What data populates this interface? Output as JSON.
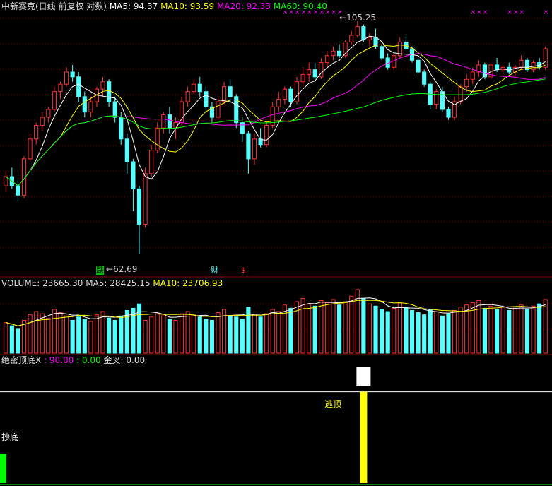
{
  "header": {
    "title": "中新赛克(日线 前复权 对数)",
    "ma5": "MA5: 94.37",
    "ma10": "MA10: 93.59",
    "ma20": "MA20: 92.33",
    "ma60": "MA60: 90.40"
  },
  "volume_header": {
    "volume": "VOLUME: 23665.30",
    "ma5": "MA5: 28425.15",
    "ma10": "MA10: 23706.93"
  },
  "indicator_header": {
    "name": "绝密顶底X",
    "line1": ": 90.00",
    "line2": ": 0.00",
    "gold": "金叉: 0.00"
  },
  "annotations": {
    "high": "105.25",
    "low": "62.69",
    "tag_die": "跌",
    "tag_cai": "财",
    "tag_s": "$",
    "chaodi": "抄底",
    "taoding": "逃顶"
  },
  "colors": {
    "up": "#FF3232",
    "down": "#54FFFF",
    "ma5": "#FFFFFF",
    "ma10": "#FFFF00",
    "ma20": "#FF00FF",
    "ma60": "#00FF00",
    "grid": "#8B0000"
  },
  "chart_data": {
    "type": "candlestick",
    "price_high": 105.25,
    "price_low": 62.69,
    "candles": [
      [
        73.0,
        75.5,
        72.0,
        74.5
      ],
      [
        74.5,
        76.0,
        72.5,
        73.0
      ],
      [
        73.0,
        74.0,
        70.5,
        71.5
      ],
      [
        71.5,
        78.0,
        71.0,
        77.5
      ],
      [
        77.5,
        82.0,
        77.0,
        81.0
      ],
      [
        81.0,
        84.0,
        80.0,
        83.5
      ],
      [
        83.5,
        86.0,
        82.5,
        85.0
      ],
      [
        85.0,
        87.0,
        84.0,
        86.5
      ],
      [
        86.5,
        91.0,
        86.0,
        90.0
      ],
      [
        90.0,
        92.0,
        88.5,
        91.5
      ],
      [
        91.5,
        95.0,
        91.0,
        94.0
      ],
      [
        94.0,
        95.5,
        92.0,
        93.0
      ],
      [
        93.0,
        94.0,
        88.0,
        89.0
      ],
      [
        89.0,
        90.0,
        85.0,
        86.0
      ],
      [
        86.0,
        89.0,
        85.0,
        88.0
      ],
      [
        88.0,
        91.0,
        87.0,
        90.5
      ],
      [
        90.5,
        93.0,
        89.0,
        92.0
      ],
      [
        92.0,
        92.5,
        87.0,
        88.0
      ],
      [
        88.0,
        89.0,
        84.0,
        85.0
      ],
      [
        85.0,
        86.0,
        80.0,
        81.0
      ],
      [
        81.0,
        82.0,
        75.0,
        77.0
      ],
      [
        77.0,
        77.5,
        69.0,
        72.5
      ],
      [
        72.5,
        73.0,
        62.69,
        67.0
      ],
      [
        67.0,
        76.0,
        66.5,
        75.0
      ],
      [
        75.0,
        80.0,
        74.5,
        79.0
      ],
      [
        79.0,
        84.0,
        78.5,
        83.0
      ],
      [
        83.0,
        86.0,
        82.0,
        85.5
      ],
      [
        85.5,
        87.0,
        82.0,
        83.0
      ],
      [
        83.0,
        85.0,
        81.0,
        84.0
      ],
      [
        84.0,
        89.0,
        83.5,
        88.0
      ],
      [
        88.0,
        91.0,
        87.0,
        90.0
      ],
      [
        90.0,
        92.5,
        89.5,
        91.5
      ],
      [
        91.5,
        93.0,
        89.0,
        90.0
      ],
      [
        90.0,
        91.0,
        86.0,
        87.0
      ],
      [
        87.0,
        88.0,
        84.0,
        85.0
      ],
      [
        85.0,
        89.0,
        84.5,
        88.0
      ],
      [
        88.0,
        92.0,
        87.5,
        91.0
      ],
      [
        91.0,
        92.5,
        88.0,
        89.0
      ],
      [
        89.0,
        89.5,
        83.0,
        84.0
      ],
      [
        84.0,
        85.0,
        80.5,
        82.0
      ],
      [
        82.0,
        82.5,
        75.0,
        77.5
      ],
      [
        77.5,
        82.0,
        76.5,
        81.0
      ],
      [
        81.0,
        83.0,
        79.5,
        80.0
      ],
      [
        80.0,
        84.0,
        79.5,
        83.5
      ],
      [
        83.5,
        88.0,
        83.0,
        87.0
      ],
      [
        87.0,
        90.0,
        86.0,
        88.5
      ],
      [
        88.5,
        91.0,
        87.5,
        90.5
      ],
      [
        90.5,
        91.0,
        87.0,
        88.0
      ],
      [
        88.0,
        93.0,
        87.5,
        92.0
      ],
      [
        92.0,
        95.0,
        91.0,
        93.5
      ],
      [
        93.5,
        96.0,
        92.0,
        94.5
      ],
      [
        94.5,
        96.0,
        92.5,
        93.0
      ],
      [
        93.0,
        97.0,
        92.5,
        96.0
      ],
      [
        96.0,
        98.5,
        95.0,
        97.5
      ],
      [
        97.5,
        99.5,
        96.5,
        98.5
      ],
      [
        98.5,
        100.0,
        97.0,
        97.5
      ],
      [
        97.5,
        101.0,
        97.0,
        100.5
      ],
      [
        100.5,
        103.0,
        100.0,
        102.0
      ],
      [
        102.0,
        105.25,
        101.5,
        104.0
      ],
      [
        104.0,
        104.5,
        100.5,
        101.0
      ],
      [
        101.0,
        102.5,
        99.5,
        101.5
      ],
      [
        101.5,
        103.5,
        99.0,
        99.5
      ],
      [
        99.5,
        100.0,
        96.5,
        97.0
      ],
      [
        97.0,
        98.0,
        94.5,
        95.0
      ],
      [
        95.0,
        98.0,
        94.5,
        97.5
      ],
      [
        97.5,
        101.5,
        97.0,
        100.5
      ],
      [
        100.5,
        102.0,
        98.5,
        99.0
      ],
      [
        99.0,
        99.5,
        96.0,
        96.5
      ],
      [
        96.5,
        97.0,
        93.5,
        94.0
      ],
      [
        94.0,
        94.5,
        91.0,
        91.5
      ],
      [
        91.5,
        92.0,
        86.5,
        87.5
      ],
      [
        87.5,
        90.5,
        86.5,
        90.0
      ],
      [
        90.0,
        91.0,
        86.0,
        86.5
      ],
      [
        86.5,
        87.0,
        84.5,
        85.0
      ],
      [
        85.0,
        89.0,
        84.5,
        88.0
      ],
      [
        88.0,
        91.5,
        87.5,
        91.0
      ],
      [
        91.0,
        93.5,
        90.0,
        92.5
      ],
      [
        92.5,
        95.0,
        91.5,
        94.0
      ],
      [
        94.0,
        96.5,
        93.0,
        95.5
      ],
      [
        95.5,
        96.0,
        92.5,
        93.0
      ],
      [
        93.0,
        96.0,
        92.5,
        95.5
      ],
      [
        95.5,
        97.0,
        94.0,
        94.5
      ],
      [
        94.5,
        95.5,
        93.0,
        95.0
      ],
      [
        95.0,
        96.0,
        93.5,
        94.0
      ],
      [
        94.0,
        95.5,
        93.0,
        95.0
      ],
      [
        95.0,
        97.5,
        94.5,
        96.5
      ],
      [
        96.5,
        97.0,
        94.0,
        94.5
      ],
      [
        94.5,
        96.5,
        94.0,
        96.0
      ],
      [
        96.0,
        97.0,
        94.5,
        95.0
      ],
      [
        95.0,
        99.5,
        94.5,
        99.0
      ]
    ],
    "volume": [
      28,
      25,
      22,
      30,
      35,
      38,
      36,
      32,
      40,
      37,
      34,
      30,
      33,
      31,
      29,
      35,
      38,
      32,
      30,
      34,
      39,
      41,
      45,
      30,
      33,
      36,
      34,
      31,
      30,
      36,
      38,
      35,
      33,
      31,
      30,
      37,
      40,
      34,
      33,
      31,
      42,
      35,
      33,
      36,
      40,
      38,
      44,
      41,
      47,
      50,
      45,
      43,
      48,
      46,
      49,
      44,
      47,
      52,
      58,
      50,
      45,
      43,
      40,
      38,
      41,
      46,
      42,
      39,
      37,
      35,
      40,
      38,
      34,
      36,
      39,
      42,
      44,
      46,
      48,
      41,
      43,
      40,
      42,
      39,
      41,
      44,
      40,
      43,
      45,
      49
    ],
    "signals": [
      {
        "index": 59,
        "label": "逃顶",
        "value": 90.0
      },
      {
        "index": 0,
        "label": "抄底",
        "value": 30.0
      }
    ],
    "indicator_levels": {
      "line1": 90.0,
      "line2": 0.0
    }
  }
}
